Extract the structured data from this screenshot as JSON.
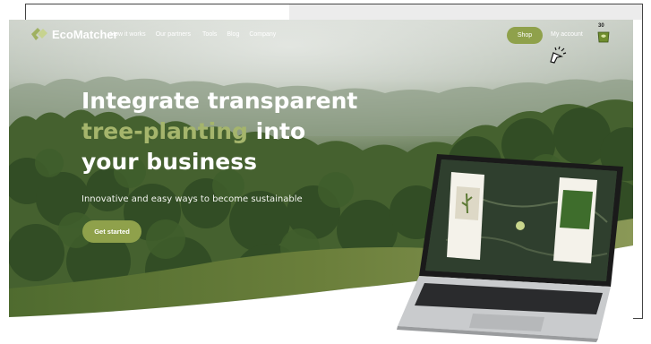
{
  "brand": {
    "name": "EcoMatcher"
  },
  "nav": {
    "links": [
      "How it works",
      "Our partners",
      "Tools",
      "Blog",
      "Company"
    ],
    "shop_label": "Shop",
    "account_label": "My account",
    "cart_count": "30"
  },
  "hero": {
    "headline_line1": "Integrate transparent",
    "headline_accent": "tree-planting",
    "headline_line2_rest": " into",
    "headline_line3": "your business",
    "subheadline": "Innovative and easy ways to become sustainable",
    "cta_label": "Get started"
  },
  "colors": {
    "accent_green": "#8fa14b",
    "accent_text": "#a5b56c",
    "forest_dark": "#2f4a26",
    "hill_green": "#4d6a2d"
  },
  "icons": [
    "logo-leaf-icon",
    "cart-icon",
    "click-cursor-icon"
  ]
}
